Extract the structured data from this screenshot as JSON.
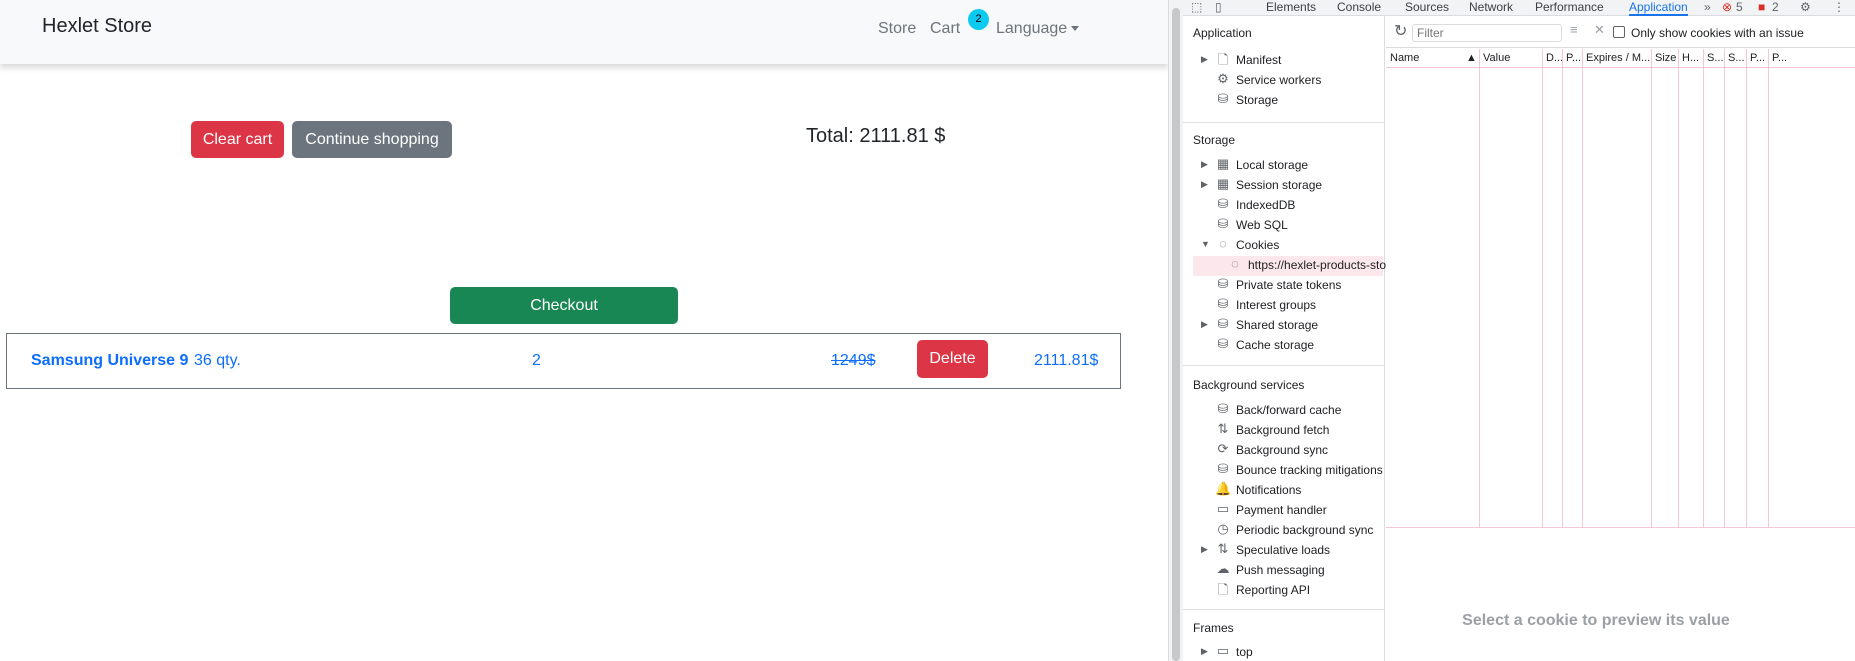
{
  "page": {
    "brand": "Hexlet Store",
    "nav": {
      "store": "Store",
      "cart": "Cart",
      "cart_count": "2",
      "language": "Language"
    },
    "buttons": {
      "clear_cart": "Clear cart",
      "continue_shopping": "Continue shopping",
      "checkout": "Checkout",
      "delete": "Delete"
    },
    "total": "Total: 2111.81 $",
    "cart_item": {
      "name": "Samsung Universe 9",
      "stock": "36 qty.",
      "count": "2",
      "old_price": "1249$",
      "sum": "2111.81$"
    },
    "colors": {
      "danger": "#dc3545",
      "secondary": "#6c757d",
      "success": "#198754",
      "link": "#0d6efd",
      "badge": "#0dcaf0"
    }
  },
  "devtools": {
    "tabs": [
      "Elements",
      "Console",
      "Sources",
      "Network",
      "Performance",
      "Application"
    ],
    "active_tab": "Application",
    "errors": "5",
    "issues": "2",
    "sections": {
      "application": {
        "title": "Application",
        "items": [
          {
            "label": "Manifest",
            "icon": "document-icon",
            "glyph": "🗋",
            "expandable": true
          },
          {
            "label": "Service workers",
            "icon": "gear-icon",
            "glyph": "⚙",
            "expandable": false
          },
          {
            "label": "Storage",
            "icon": "database-icon",
            "glyph": "⛁",
            "expandable": false
          }
        ]
      },
      "storage": {
        "title": "Storage",
        "items": [
          {
            "label": "Local storage",
            "icon": "table-icon",
            "glyph": "▦",
            "expandable": true
          },
          {
            "label": "Session storage",
            "icon": "table-icon",
            "glyph": "▦",
            "expandable": true
          },
          {
            "label": "IndexedDB",
            "icon": "database-icon",
            "glyph": "⛁",
            "expandable": false
          },
          {
            "label": "Web SQL",
            "icon": "database-icon",
            "glyph": "⛁",
            "expandable": false
          },
          {
            "label": "Cookies",
            "icon": "cookie-icon",
            "glyph": "◌",
            "expandable": true,
            "expanded": true
          },
          {
            "label": "https://hexlet-products-sto",
            "icon": "cookie-icon",
            "glyph": "◌",
            "child": true,
            "selected": true
          },
          {
            "label": "Private state tokens",
            "icon": "database-icon",
            "glyph": "⛁",
            "expandable": false
          },
          {
            "label": "Interest groups",
            "icon": "database-icon",
            "glyph": "⛁",
            "expandable": false
          },
          {
            "label": "Shared storage",
            "icon": "database-icon",
            "glyph": "⛁",
            "expandable": true
          },
          {
            "label": "Cache storage",
            "icon": "database-icon",
            "glyph": "⛁",
            "expandable": false
          }
        ]
      },
      "background": {
        "title": "Background services",
        "items": [
          {
            "label": "Back/forward cache",
            "icon": "database-icon",
            "glyph": "⛁",
            "expandable": false
          },
          {
            "label": "Background fetch",
            "icon": "arrows-icon",
            "glyph": "⇅",
            "expandable": false
          },
          {
            "label": "Background sync",
            "icon": "sync-icon",
            "glyph": "⟳",
            "expandable": false
          },
          {
            "label": "Bounce tracking mitigations",
            "icon": "database-icon",
            "glyph": "⛁",
            "expandable": false
          },
          {
            "label": "Notifications",
            "icon": "bell-icon",
            "glyph": "🔔",
            "expandable": false
          },
          {
            "label": "Payment handler",
            "icon": "card-icon",
            "glyph": "▭",
            "expandable": false
          },
          {
            "label": "Periodic background sync",
            "icon": "clock-icon",
            "glyph": "◷",
            "expandable": false
          },
          {
            "label": "Speculative loads",
            "icon": "arrows-icon",
            "glyph": "⇅",
            "expandable": true
          },
          {
            "label": "Push messaging",
            "icon": "cloud-icon",
            "glyph": "☁",
            "expandable": false
          },
          {
            "label": "Reporting API",
            "icon": "document-icon",
            "glyph": "🗋",
            "expandable": false
          }
        ]
      },
      "frames": {
        "title": "Frames",
        "items": [
          {
            "label": "top",
            "icon": "frame-icon",
            "glyph": "▭",
            "expandable": true
          }
        ]
      }
    },
    "cookies": {
      "filter_placeholder": "Filter",
      "only_issue_label": "Only show cookies with an issue",
      "columns": [
        "Name",
        "Value",
        "D...",
        "P...",
        "Expires / M...",
        "Size",
        "H...",
        "S...",
        "S...",
        "P...",
        "P..."
      ],
      "preview_text": "Select a cookie to preview its value"
    }
  }
}
